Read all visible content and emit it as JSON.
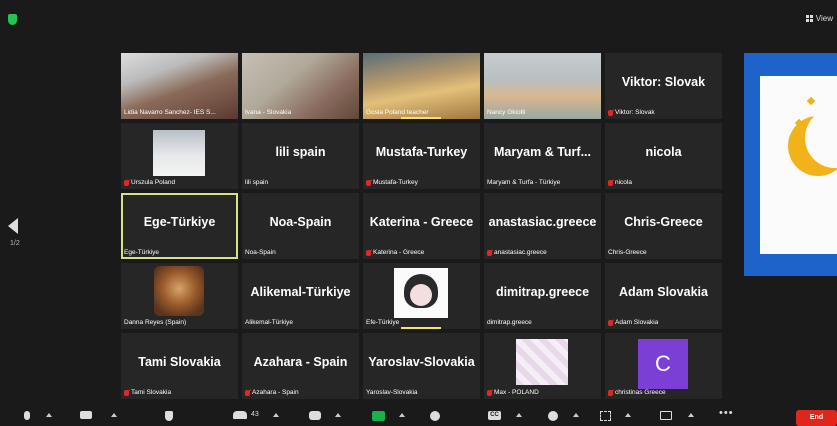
{
  "header": {
    "view_label": "View",
    "shield_color": "#23c552"
  },
  "pagination": {
    "current": "1/2"
  },
  "gallery": {
    "rows": [
      [
        {
          "label": "Lidia Navarro Sanchez- IES S...",
          "muted": false,
          "video": "v1"
        },
        {
          "label": "Ivana - Slovakia",
          "muted": false,
          "video": "v2"
        },
        {
          "label": "Gosia Poland teacher",
          "muted": false,
          "video": "v3",
          "speaking": true
        },
        {
          "label": "Nancy Gkiotli",
          "muted": false,
          "video": "v4"
        },
        {
          "big": "Viktor: Slovak",
          "label": "Viktor: Slovak",
          "muted": true
        }
      ],
      [
        {
          "label": "Urszula Poland",
          "muted": true,
          "thumb": "snow"
        },
        {
          "big": "lili spain",
          "label": "lili spain",
          "muted": false
        },
        {
          "big": "Mustafa-Turkey",
          "label": "Mustafa-Turkey",
          "muted": true
        },
        {
          "big": "Maryam & Turf...",
          "label": "Maryam & Turfa - Türkiye",
          "muted": false
        },
        {
          "big": "nicola",
          "label": "nicola",
          "muted": true
        }
      ],
      [
        {
          "big": "Ege-Türkiye",
          "label": "Ege-Türkiye",
          "muted": false,
          "active": true
        },
        {
          "big": "Noa-Spain",
          "label": "Noa-Spain",
          "muted": false
        },
        {
          "big": "Katerina - Greece",
          "label": "Katerina - Greece",
          "muted": true
        },
        {
          "big": "anastasiac.greece",
          "label": "anastasiac.greece",
          "muted": true
        },
        {
          "big": "Chris-Greece",
          "label": "Chris-Greece",
          "muted": false
        }
      ],
      [
        {
          "label": "Danna Reyes (Spain)",
          "muted": false,
          "thumb": "lion"
        },
        {
          "big": "Alikemal-Türkiye",
          "label": "Alikemal-Türkiye",
          "muted": false
        },
        {
          "label": "Efe-Türkiye",
          "muted": false,
          "thumb": "girl",
          "speaking": true
        },
        {
          "big": "dimitrap.greece",
          "label": "dimitrap.greece",
          "muted": false
        },
        {
          "big": "Adam Slovakia",
          "label": "Adam Slovakia",
          "muted": true
        }
      ],
      [
        {
          "big": "Tami Slovakia",
          "label": "Tami Slovakia",
          "muted": true
        },
        {
          "big": "Azahara - Spain",
          "label": "Azahara - Spain",
          "muted": true
        },
        {
          "big": "Yaroslav-Slovakia",
          "label": "Yaroslav-Slovakia",
          "muted": false
        },
        {
          "label": "Max - POLAND",
          "muted": true,
          "thumb": "art"
        },
        {
          "label": "christinas Greece",
          "muted": true,
          "avatar_letter": "C",
          "avatar_color": "#7c3fd6"
        }
      ]
    ]
  },
  "toolbar": {
    "participants_count": "43",
    "cc_label": "CC",
    "end_label": "End",
    "more_label": "•••",
    "share_color": "#19b24a",
    "end_color": "#e0261b"
  }
}
